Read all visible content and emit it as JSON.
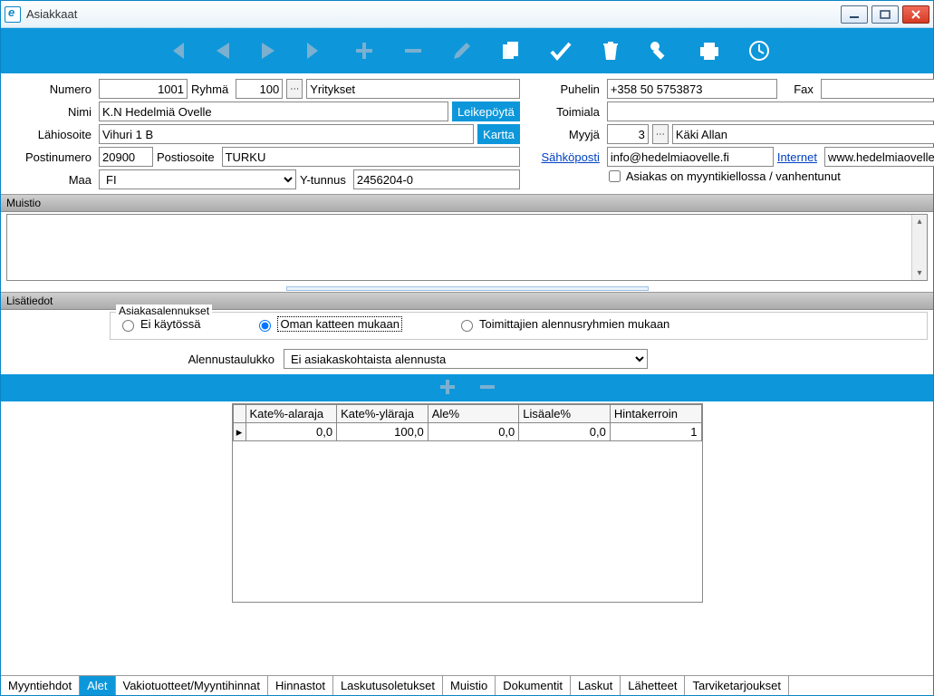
{
  "window": {
    "title": "Asiakkaat"
  },
  "form": {
    "numero": {
      "label": "Numero",
      "value": "1001"
    },
    "ryhma": {
      "label": "Ryhmä",
      "value": "100",
      "desc": "Yritykset"
    },
    "nimi": {
      "label": "Nimi",
      "value": "K.N Hedelmiä Ovelle",
      "btn": "Leikepöytä"
    },
    "lahiosoite": {
      "label": "Lähiosoite",
      "value": "Vihuri 1 B",
      "btn": "Kartta"
    },
    "postinumero": {
      "label": "Postinumero",
      "value": "20900"
    },
    "postiosoite": {
      "label": "Postiosoite",
      "value": "TURKU"
    },
    "maa": {
      "label": "Maa",
      "value": "FI"
    },
    "ytunnus": {
      "label": "Y-tunnus",
      "value": "2456204-0"
    },
    "puhelin": {
      "label": "Puhelin",
      "value": "+358 50 5753873"
    },
    "fax": {
      "label": "Fax",
      "value": ""
    },
    "toimiala": {
      "label": "Toimiala",
      "value": ""
    },
    "myyja": {
      "label": "Myyjä",
      "value": "3",
      "desc": "Käki Allan"
    },
    "sahkoposti": {
      "label": "Sähköposti",
      "value": "info@hedelmiaovelle.fi"
    },
    "internet": {
      "label": "Internet",
      "value": "www.hedelmiaovelle.fi"
    },
    "myyntikielto": {
      "label": "Asiakas on myyntikiellossa / vanhentunut",
      "checked": false
    }
  },
  "sections": {
    "muistio": "Muistio",
    "lisatiedot": "Lisätiedot",
    "asiakasalennukset": "Asiakasalennukset"
  },
  "radios": {
    "ei": "Ei käytössä",
    "oman": "Oman katteen mukaan",
    "toimittajien": "Toimittajien alennusryhmien mukaan"
  },
  "alennustaulukko": {
    "label": "Alennustaulukko",
    "value": "Ei asiakaskohtaista alennusta"
  },
  "grid": {
    "headers": [
      "Kate%-alaraja",
      "Kate%-yläraja",
      "Ale%",
      "Lisäale%",
      "Hintakerroin"
    ],
    "row": [
      "0,0",
      "100,0",
      "0,0",
      "0,0",
      "1"
    ]
  },
  "tabs": [
    "Myyntiehdot",
    "Alet",
    "Vakiotuotteet/Myyntihinnat",
    "Hinnastot",
    "Laskutusoletukset",
    "Muistio",
    "Dokumentit",
    "Laskut",
    "Lähetteet",
    "Tarviketarjoukset"
  ],
  "active_tab": 1
}
